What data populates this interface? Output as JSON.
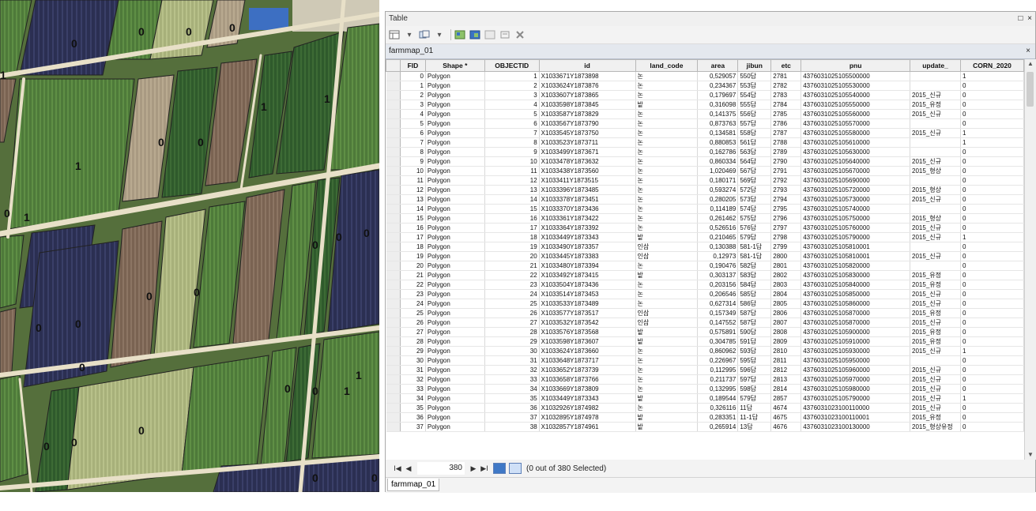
{
  "window": {
    "title": "Table",
    "restore_glyph": "□",
    "close_glyph": "×"
  },
  "layer_tab": {
    "label": "farmmap_01",
    "close_glyph": "×"
  },
  "toolbar": {
    "icons": [
      "table-options-icon",
      "related-tables-icon",
      "select-by-attributes-icon",
      "switch-selection-icon",
      "clear-selection-icon",
      "zoom-to-selected-icon",
      "delete-selected-icon"
    ]
  },
  "columns": [
    "",
    "FID",
    "Shape *",
    "OBJECTID",
    "id",
    "land_code",
    "area",
    "jibun",
    "etc",
    "pnu",
    "update_",
    "CORN_2020"
  ],
  "rows": [
    [
      "0",
      "Polygon",
      "1",
      "X1033671Y1873898",
      "논",
      "0,529057",
      "550답",
      "2781",
      "4376031025105500000",
      "",
      "1"
    ],
    [
      "1",
      "Polygon",
      "2",
      "X1033624Y1873876",
      "논",
      "0,234367",
      "553답",
      "2782",
      "4376031025105530000",
      "",
      "0"
    ],
    [
      "2",
      "Polygon",
      "3",
      "X1033607Y1873865",
      "논",
      "0,179697",
      "554답",
      "2783",
      "4376031025105540000",
      "2015_신규",
      "0"
    ],
    [
      "3",
      "Polygon",
      "4",
      "X1033598Y1873845",
      "밭",
      "0,316098",
      "555답",
      "2784",
      "4376031025105550000",
      "2015_유정",
      "0"
    ],
    [
      "4",
      "Polygon",
      "5",
      "X1033587Y1873829",
      "논",
      "0,141375",
      "556답",
      "2785",
      "4376031025105560000",
      "2015_신규",
      "0"
    ],
    [
      "5",
      "Polygon",
      "6",
      "X1033567Y1873790",
      "논",
      "0,873763",
      "557답",
      "2786",
      "4376031025105570000",
      "",
      "0"
    ],
    [
      "6",
      "Polygon",
      "7",
      "X1033545Y1873750",
      "논",
      "0,134581",
      "558답",
      "2787",
      "4376031025105580000",
      "2015_신규",
      "1"
    ],
    [
      "7",
      "Polygon",
      "8",
      "X1033523Y1873711",
      "논",
      "0,880853",
      "561답",
      "2788",
      "4376031025105610000",
      "",
      "1"
    ],
    [
      "8",
      "Polygon",
      "9",
      "X1033499Y1873671",
      "논",
      "0,162786",
      "563답",
      "2789",
      "4376031025105630000",
      "",
      "0"
    ],
    [
      "9",
      "Polygon",
      "10",
      "X1033478Y1873632",
      "논",
      "0,860334",
      "564답",
      "2790",
      "4376031025105640000",
      "2015_신규",
      "0"
    ],
    [
      "10",
      "Polygon",
      "11",
      "X1033438Y1873560",
      "논",
      "1,020469",
      "567답",
      "2791",
      "4376031025105670000",
      "2015_형상",
      "0"
    ],
    [
      "11",
      "Polygon",
      "12",
      "X1033411Y1873515",
      "논",
      "0,180171",
      "569답",
      "2792",
      "4376031025105690000",
      "",
      "0"
    ],
    [
      "12",
      "Polygon",
      "13",
      "X1033396Y1873485",
      "논",
      "0,593274",
      "572답",
      "2793",
      "4376031025105720000",
      "2015_형상",
      "0"
    ],
    [
      "13",
      "Polygon",
      "14",
      "X1033378Y1873451",
      "논",
      "0,280205",
      "573답",
      "2794",
      "4376031025105730000",
      "2015_신규",
      "0"
    ],
    [
      "14",
      "Polygon",
      "15",
      "X1033370Y1873436",
      "논",
      "0,114189",
      "574답",
      "2795",
      "4376031025105740000",
      "",
      "0"
    ],
    [
      "15",
      "Polygon",
      "16",
      "X1033361Y1873422",
      "논",
      "0,261462",
      "575답",
      "2796",
      "4376031025105750000",
      "2015_형상",
      "0"
    ],
    [
      "16",
      "Polygon",
      "17",
      "X1033364Y1873392",
      "논",
      "0,526516",
      "576답",
      "2797",
      "4376031025105760000",
      "2015_신규",
      "0"
    ],
    [
      "17",
      "Polygon",
      "18",
      "X1033449Y1873343",
      "밭",
      "0,210465",
      "579답",
      "2798",
      "4376031025105790000",
      "2015_신규",
      "1"
    ],
    [
      "18",
      "Polygon",
      "19",
      "X1033490Y1873357",
      "인삼",
      "0,130388",
      "581-1답",
      "2799",
      "4376031025105810001",
      "",
      "0"
    ],
    [
      "19",
      "Polygon",
      "20",
      "X1033445Y1873383",
      "인삼",
      "0,12973",
      "581-1답",
      "2800",
      "4376031025105810001",
      "2015_신규",
      "0"
    ],
    [
      "20",
      "Polygon",
      "21",
      "X1033480Y1873394",
      "논",
      "0,190476",
      "582답",
      "2801",
      "4376031025105820000",
      "",
      "0"
    ],
    [
      "21",
      "Polygon",
      "22",
      "X1033492Y1873415",
      "밭",
      "0,303137",
      "583답",
      "2802",
      "4376031025105830000",
      "2015_유정",
      "0"
    ],
    [
      "22",
      "Polygon",
      "23",
      "X1033504Y1873436",
      "논",
      "0,203156",
      "584답",
      "2803",
      "4376031025105840000",
      "2015_유정",
      "0"
    ],
    [
      "23",
      "Polygon",
      "24",
      "X1033514Y1873453",
      "논",
      "0,206546",
      "585답",
      "2804",
      "4376031025105850000",
      "2015_신규",
      "0"
    ],
    [
      "24",
      "Polygon",
      "25",
      "X1033533Y1873489",
      "논",
      "0,627314",
      "586답",
      "2805",
      "4376031025105860000",
      "2015_신규",
      "0"
    ],
    [
      "25",
      "Polygon",
      "26",
      "X1033577Y1873517",
      "인삼",
      "0,157349",
      "587답",
      "2806",
      "4376031025105870000",
      "2015_유정",
      "0"
    ],
    [
      "26",
      "Polygon",
      "27",
      "X1033532Y1873542",
      "인삼",
      "0,147552",
      "587답",
      "2807",
      "4376031025105870000",
      "2015_신규",
      "0"
    ],
    [
      "27",
      "Polygon",
      "28",
      "X1033576Y1873568",
      "밭",
      "0,575891",
      "590답",
      "2808",
      "4376031025105900000",
      "2015_유정",
      "0"
    ],
    [
      "28",
      "Polygon",
      "29",
      "X1033598Y1873607",
      "밭",
      "0,304785",
      "591답",
      "2809",
      "4376031025105910000",
      "2015_유정",
      "0"
    ],
    [
      "29",
      "Polygon",
      "30",
      "X1033624Y1873660",
      "논",
      "0,860962",
      "593답",
      "2810",
      "4376031025105930000",
      "2015_신규",
      "1"
    ],
    [
      "30",
      "Polygon",
      "31",
      "X1033648Y1873717",
      "논",
      "0,226967",
      "595답",
      "2811",
      "4376031025105950000",
      "",
      "0"
    ],
    [
      "31",
      "Polygon",
      "32",
      "X1033652Y1873739",
      "논",
      "0,112995",
      "596답",
      "2812",
      "4376031025105960000",
      "2015_신규",
      "0"
    ],
    [
      "32",
      "Polygon",
      "33",
      "X1033658Y1873766",
      "논",
      "0,211737",
      "597답",
      "2813",
      "4376031025105970000",
      "2015_신규",
      "0"
    ],
    [
      "33",
      "Polygon",
      "34",
      "X1033669Y1873809",
      "논",
      "0,132995",
      "598답",
      "2814",
      "4376031025105980000",
      "2015_신규",
      "0"
    ],
    [
      "34",
      "Polygon",
      "35",
      "X1033449Y1873343",
      "밭",
      "0,189544",
      "579답",
      "2857",
      "4376031025105790000",
      "2015_신규",
      "1"
    ],
    [
      "35",
      "Polygon",
      "36",
      "X1032926Y1874982",
      "논",
      "0,326116",
      "11답",
      "4674",
      "4376031023100110000",
      "2015_신규",
      "0"
    ],
    [
      "36",
      "Polygon",
      "37",
      "X1032895Y1874978",
      "밭",
      "0,283351",
      "11-1답",
      "4675",
      "4376031023100110001",
      "2015_유정",
      "0"
    ],
    [
      "37",
      "Polygon",
      "38",
      "X1032857Y1874961",
      "밭",
      "0,265914",
      "13답",
      "4676",
      "4376031023100130000",
      "2015_형상유정",
      "0"
    ]
  ],
  "navigation": {
    "first_glyph": "I◀",
    "prev_glyph": "◀",
    "record": "380",
    "next_glyph": "▶",
    "last_glyph": "▶I",
    "selection_text": "(0 out of 380 Selected)"
  },
  "bottom_tab": {
    "label": "farmmap_01"
  },
  "map_labels": [
    {
      "text": "0"
    },
    {
      "text": "0"
    },
    {
      "text": "0"
    },
    {
      "text": "0"
    },
    {
      "text": "1"
    },
    {
      "text": "1"
    },
    {
      "text": "1"
    },
    {
      "text": "0"
    },
    {
      "text": "1"
    },
    {
      "text": "0"
    },
    {
      "text": "1"
    },
    {
      "text": "0"
    },
    {
      "text": "0"
    },
    {
      "text": "0"
    },
    {
      "text": "0"
    },
    {
      "text": "0"
    },
    {
      "text": "0"
    },
    {
      "text": "0"
    },
    {
      "text": "0"
    },
    {
      "text": "0"
    },
    {
      "text": "0"
    },
    {
      "text": "1"
    },
    {
      "text": "0"
    },
    {
      "text": "0"
    },
    {
      "text": "0"
    },
    {
      "text": "0"
    },
    {
      "text": "1"
    },
    {
      "text": "0"
    },
    {
      "text": "0"
    }
  ],
  "colors": {
    "road": "#e8e0c8",
    "window_bg": "#f3f3f3",
    "header_bg": "#f0f0f0",
    "tab_bg": "#e4e8ee"
  }
}
